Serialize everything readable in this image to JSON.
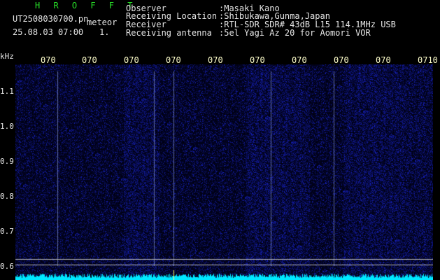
{
  "header": {
    "program": "H R O F F T",
    "filename": "UT2508030700.pn",
    "mode": "meteor",
    "datetime": "25.08.03 07:00",
    "count": "1.",
    "labels": [
      "Observer",
      "Receiving Location",
      "Receiver",
      "Receiving antenna"
    ],
    "values": [
      ":Masaki Kano",
      ":Shibukawa,Gunma,Japan",
      ":RTL-SDR SDR# 43dB L15 114.1MHz USB",
      ":5el Yagi Az 20 for Aomori VOR"
    ]
  },
  "axis": {
    "unit": "kHz",
    "y_ticks": [
      "1.1",
      "1.0",
      "0.9",
      "0.8",
      "0.7",
      "0.6"
    ],
    "x_ticks": [
      "070",
      "070",
      "070",
      "070",
      "070",
      "070",
      "070",
      "070",
      "070",
      "0710"
    ]
  },
  "colors": {
    "background": "#000000",
    "noise": "#1a1f8c",
    "signal": "#a8b8ff",
    "baseline": "#00ffff",
    "ticks": "#ffffcc",
    "title": "#28e028"
  }
}
